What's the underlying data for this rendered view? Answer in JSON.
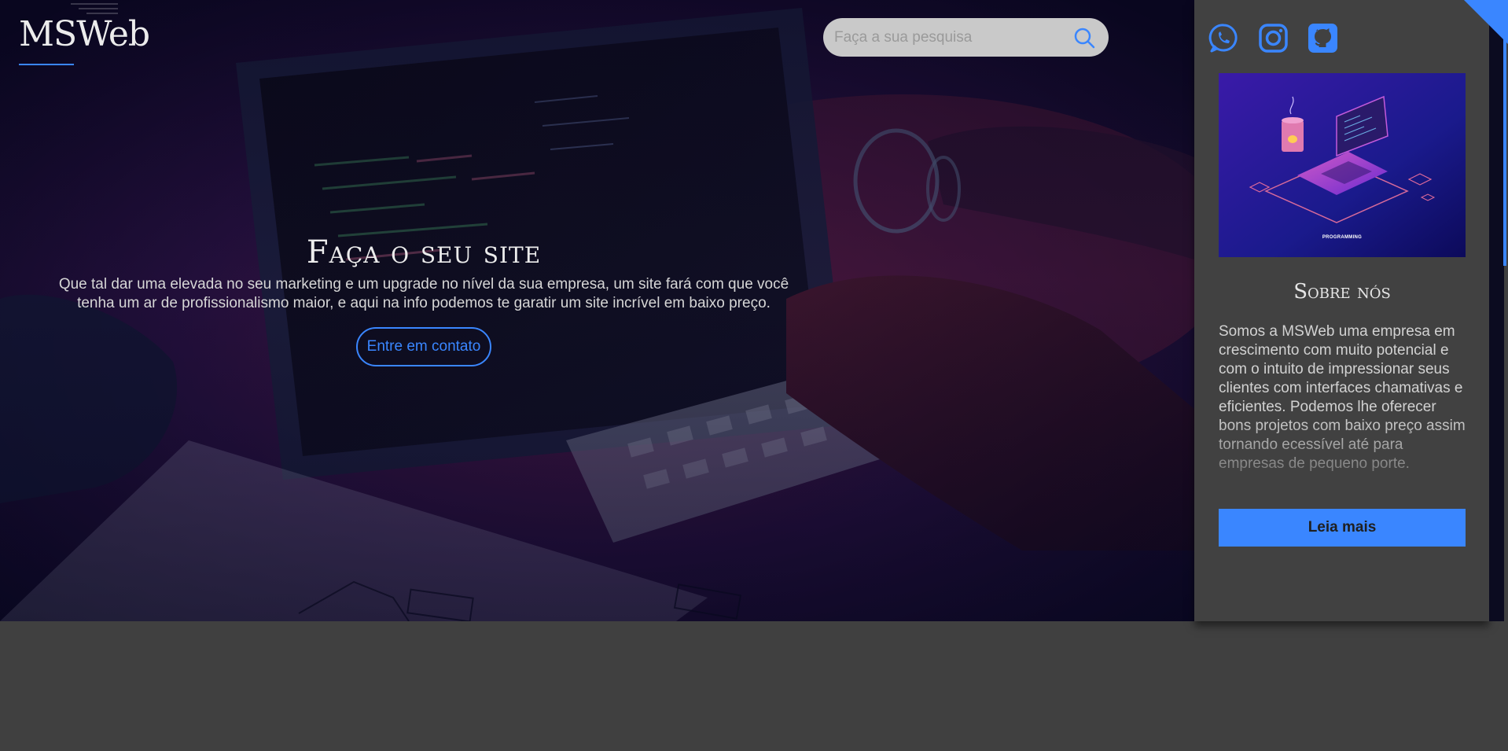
{
  "header": {
    "logo": "MSWeb"
  },
  "search": {
    "placeholder": "Faça a sua pesquisa",
    "value": ""
  },
  "hero": {
    "title": "Faça o seu site",
    "text": "Que tal dar uma elevada no seu marketing e um upgrade no nível da sua empresa, um site fará com que você tenha um ar de profissionalismo maior, e aqui na info podemos te garatir um site incrível em baixo preço.",
    "cta_label": "Entre em contato"
  },
  "social": {
    "icons": [
      "whatsapp-icon",
      "instagram-icon",
      "github-icon"
    ]
  },
  "sidebar": {
    "image_caption": "PROGRAMMING",
    "about_title": "Sobre nós",
    "about_text": "Somos a MSWeb uma empresa em crescimento com muito potencial e com o intuito de impressionar seus clientes com interfaces chamativas e eficientes. Podemos lhe oferecer bons projetos com baixo preço assim tornando ecessível até para empresas de pequeno porte.",
    "read_more_label": "Leia mais"
  },
  "colors": {
    "accent": "#3a86ff",
    "page_background": "#404040",
    "sidebar_background": "#414141",
    "hero_tint": "#1a0f3a"
  }
}
